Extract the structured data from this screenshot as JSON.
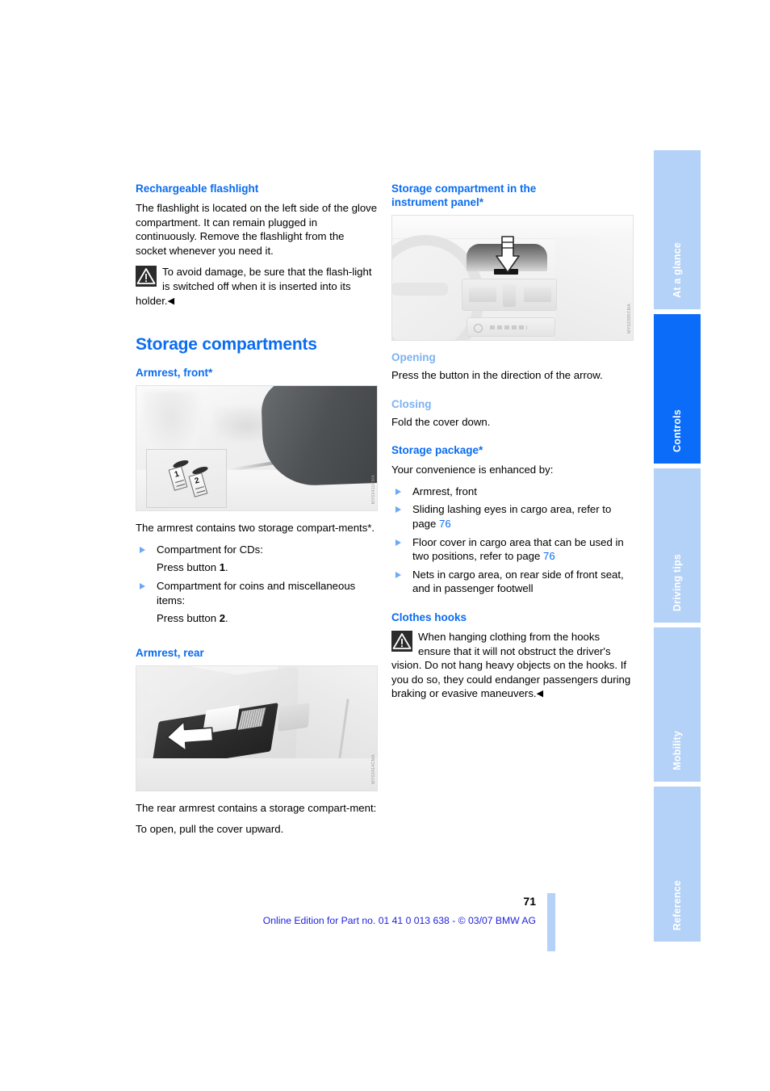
{
  "page": {
    "number": "71",
    "footer_note": "Online Edition for Part no. 01 41 0 013 638 - © 03/07 BMW AG"
  },
  "left_column": {
    "flashlight": {
      "heading": "Rechargeable flashlight",
      "body": "The flashlight is located on the left side of the glove compartment. It can remain plugged in continuously. Remove the flashlight from the socket whenever you need it.",
      "warning": "To avoid damage, be sure that the flash-light is switched off when it is inserted into its holder.",
      "warning_end_mark": "◀"
    },
    "storage_compartments": {
      "title": "Storage compartments"
    },
    "armrest_front": {
      "heading": "Armrest, front*",
      "figure_code": "MY02411CMA",
      "callout_1": "1",
      "callout_2": "2",
      "intro": "The armrest contains two storage compart-ments*.",
      "items": [
        {
          "label": "Compartment for CDs:",
          "action_prefix": "Press button ",
          "action_bold": "1",
          "action_suffix": "."
        },
        {
          "label": "Compartment for coins and miscellaneous items:",
          "action_prefix": "Press button ",
          "action_bold": "2",
          "action_suffix": "."
        }
      ]
    },
    "armrest_rear": {
      "heading": "Armrest, rear",
      "figure_code": "MY02414CMA",
      "body_1": "The rear armrest contains a storage compart-ment:",
      "body_2": "To open, pull the cover upward."
    }
  },
  "right_column": {
    "instrument_panel": {
      "heading_line_1": "Storage compartment in the",
      "heading_line_2": "instrument panel*",
      "figure_code": "MY02395CMA"
    },
    "opening": {
      "heading": "Opening",
      "body": "Press the button in the direction of the arrow."
    },
    "closing": {
      "heading": "Closing",
      "body": "Fold the cover down."
    },
    "storage_package": {
      "heading": "Storage package*",
      "intro": "Your convenience is enhanced by:",
      "items": [
        {
          "text": "Armrest, front",
          "ref": "",
          "ref_suffix": ""
        },
        {
          "text": "Sliding lashing eyes in cargo area, refer to page ",
          "ref": "76",
          "ref_suffix": ""
        },
        {
          "text": "Floor cover in cargo area that can be used in two positions, refer to page ",
          "ref": "76",
          "ref_suffix": ""
        },
        {
          "text": "Nets in cargo area, on rear side of front seat, and in passenger footwell",
          "ref": "",
          "ref_suffix": ""
        }
      ]
    },
    "clothes_hooks": {
      "heading": "Clothes hooks",
      "warning": "When hanging clothing from the hooks ensure that it will not obstruct the driver's vision. Do not hang heavy objects on the hooks. If you do so, they could endanger passengers during braking or evasive maneuvers.",
      "warning_end_mark": "◀"
    }
  },
  "tabs": [
    {
      "label": "At a glance",
      "active": false
    },
    {
      "label": "Controls",
      "active": true
    },
    {
      "label": "Driving tips",
      "active": false
    },
    {
      "label": "Mobility",
      "active": false
    },
    {
      "label": "Reference",
      "active": false
    }
  ],
  "colors": {
    "heading_blue": "#0a6cf0",
    "minor_heading_blue": "#7db2f2",
    "tab_inactive": "#b4d2f7",
    "tab_active": "#0a6cf8",
    "footer_blue": "#2222dd",
    "bullet_blue": "#6aa9f5"
  }
}
